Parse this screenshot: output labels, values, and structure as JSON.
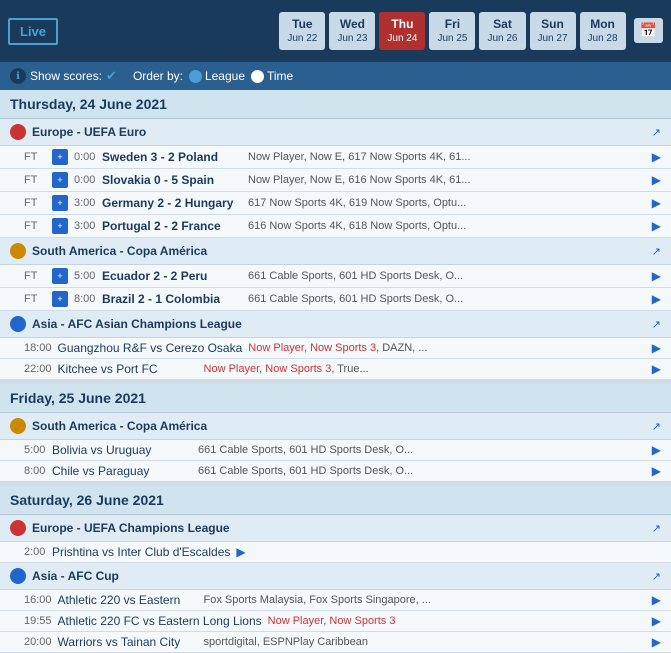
{
  "header": {
    "live_label": "Live",
    "days": [
      {
        "name": "Tue",
        "date": "Jun 22",
        "active": false
      },
      {
        "name": "Wed",
        "date": "Jun 23",
        "active": false
      },
      {
        "name": "Thu",
        "date": "Jun 24",
        "active": true
      },
      {
        "name": "Fri",
        "date": "Jun 25",
        "active": false
      },
      {
        "name": "Sat",
        "date": "Jun 26",
        "active": false
      },
      {
        "name": "Sun",
        "date": "Jun 27",
        "active": false
      },
      {
        "name": "Mon",
        "date": "Jun 28",
        "active": false
      }
    ]
  },
  "subheader": {
    "show_scores_label": "Show scores:",
    "order_by_label": "Order by:",
    "league_label": "League",
    "time_label": "Time"
  },
  "sections": [
    {
      "day": "Thursday, 24 June 2021",
      "leagues": [
        {
          "name": "Europe - UEFA Euro",
          "icon_class": "icon-europe",
          "matches": [
            {
              "status": "FT",
              "time": "0:00",
              "score": "Sweden 3 - 2 Poland",
              "channels": "Now Player, Now E, 617 Now Sports 4K, 61..."
            },
            {
              "status": "FT",
              "time": "0:00",
              "score": "Slovakia 0 - 5 Spain",
              "channels": "Now Player, Now E, 616 Now Sports 4K, 61..."
            },
            {
              "status": "FT",
              "time": "3:00",
              "score": "Germany 2 - 2 Hungary",
              "channels": "617 Now Sports 4K, 619 Now Sports, Optu..."
            },
            {
              "status": "FT",
              "time": "3:00",
              "score": "Portugal 2 - 2 France",
              "channels": "616 Now Sports 4K, 618 Now Sports, Optu..."
            }
          ]
        },
        {
          "name": "South America - Copa América",
          "icon_class": "icon-sa",
          "matches": [
            {
              "status": "FT",
              "time": "5:00",
              "score": "Ecuador 2 - 2 Peru",
              "channels": "661 Cable Sports, 601 HD Sports Desk, O..."
            },
            {
              "status": "FT",
              "time": "8:00",
              "score": "Brazil 2 - 1 Colombia",
              "channels": "661 Cable Sports, 601 HD Sports Desk, O..."
            }
          ]
        },
        {
          "name": "Asia - AFC Asian Champions League",
          "icon_class": "icon-asia",
          "matches": [
            {
              "status": "18:00",
              "time": null,
              "score": null,
              "name": "Guangzhou R&F vs Cerezo Osaka",
              "channels": "Now Player, Now Sports 3, DAZN, ...",
              "channels_red": true
            },
            {
              "status": "22:00",
              "time": null,
              "score": null,
              "name": "Kitchee vs Port FC",
              "channels": "Now Player, Now Sports 3, True...",
              "channels_red": true
            }
          ]
        }
      ]
    },
    {
      "day": "Friday, 25 June 2021",
      "leagues": [
        {
          "name": "South America - Copa América",
          "icon_class": "icon-sa",
          "matches": [
            {
              "status": "5:00",
              "time": null,
              "score": null,
              "name": "Bolivia vs Uruguay",
              "channels": "661 Cable Sports, 601 HD Sports Desk, O..."
            },
            {
              "status": "8:00",
              "time": null,
              "score": null,
              "name": "Chile vs Paraguay",
              "channels": "661 Cable Sports, 601 HD Sports Desk, O..."
            }
          ]
        }
      ]
    },
    {
      "day": "Saturday, 26 June 2021",
      "leagues": [
        {
          "name": "Europe - UEFA Champions League",
          "icon_class": "icon-europe",
          "matches": [
            {
              "status": "2:00",
              "time": null,
              "score": null,
              "name": "Prishtina vs Inter Club d'Escaldes",
              "channels": null
            }
          ]
        },
        {
          "name": "Asia - AFC Cup",
          "icon_class": "icon-asia",
          "matches": [
            {
              "status": "16:00",
              "time": null,
              "score": null,
              "name": "Athletic 220 vs Eastern",
              "channels": "Fox Sports Malaysia, Fox Sports Singapore, ..."
            },
            {
              "status": "19:55",
              "time": null,
              "score": null,
              "name": "Athletic 220 FC vs Eastern Long Lions",
              "channels": "Now Player, Now Sports 3",
              "channels_red": true
            },
            {
              "status": "20:00",
              "time": null,
              "score": null,
              "name": "Warriors vs Tainan City",
              "channels": "sportdigital, ESPNPlay Caribbean"
            }
          ]
        }
      ]
    }
  ]
}
